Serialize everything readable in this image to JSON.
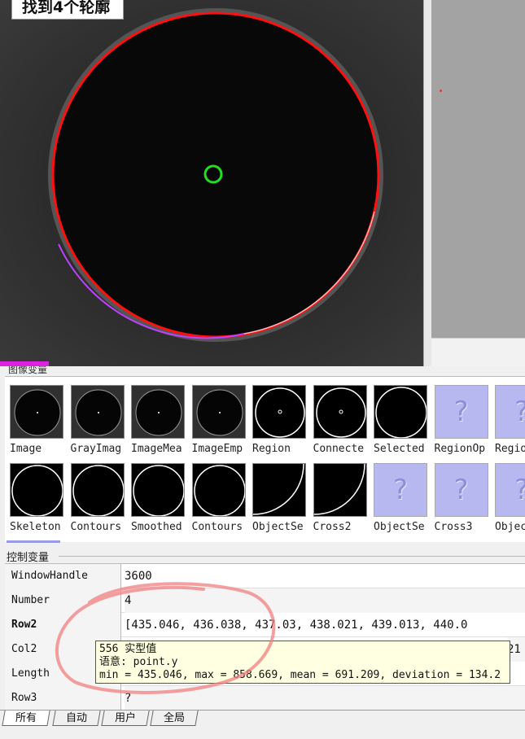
{
  "graphics": {
    "status_label": "找到4个轮廓"
  },
  "image_variables": {
    "title": "图像变量",
    "items": [
      {
        "label": "Image",
        "kind": "gray-disc"
      },
      {
        "label": "GrayImag",
        "kind": "gray-disc"
      },
      {
        "label": "ImageMea",
        "kind": "gray-disc"
      },
      {
        "label": "ImageEmp",
        "kind": "gray-disc"
      },
      {
        "label": "Region",
        "kind": "circle-dot"
      },
      {
        "label": "Connecte",
        "kind": "circle-dot"
      },
      {
        "label": "Selected",
        "kind": "circle"
      },
      {
        "label": "RegionOp",
        "kind": "unknown"
      },
      {
        "label": "Regio",
        "kind": "unknown"
      },
      {
        "label": "Skeleton",
        "kind": "circle"
      },
      {
        "label": "Contours",
        "kind": "circle"
      },
      {
        "label": "Smoothed",
        "kind": "circle"
      },
      {
        "label": "Contours",
        "kind": "circle"
      },
      {
        "label": "ObjectSe",
        "kind": "arc"
      },
      {
        "label": "Cross2",
        "kind": "arc"
      },
      {
        "label": "ObjectSe",
        "kind": "unknown"
      },
      {
        "label": "Cross3",
        "kind": "unknown"
      },
      {
        "label": "Objec",
        "kind": "unknown"
      }
    ]
  },
  "control_variables": {
    "title": "控制变量",
    "rows": [
      {
        "name": "WindowHandle",
        "value": "3600"
      },
      {
        "name": "Number",
        "value": "4"
      },
      {
        "name": "Row2",
        "value": "[435.046, 436.038, 437.03, 438.021, 439.013, 440.0"
      },
      {
        "name": "Col2",
        "value": "21"
      },
      {
        "name": "Length",
        "value": ""
      },
      {
        "name": "Row3",
        "value": "?"
      }
    ]
  },
  "tooltip": {
    "line1": "556 实型值",
    "line2": "语意: point.y",
    "line3": "min = 435.046, max = 858.669, mean = 691.209, deviation = 134.2"
  },
  "tabs": [
    {
      "label": "所有",
      "active": true
    },
    {
      "label": "自动",
      "active": false
    },
    {
      "label": "用户",
      "active": false
    },
    {
      "label": "全局",
      "active": false
    }
  ],
  "colors": {
    "contour_red": "#ff1010",
    "circle_green": "#22dd22",
    "annotation_pink": "#f08080",
    "placeholder_violet": "#b8b8f0"
  }
}
